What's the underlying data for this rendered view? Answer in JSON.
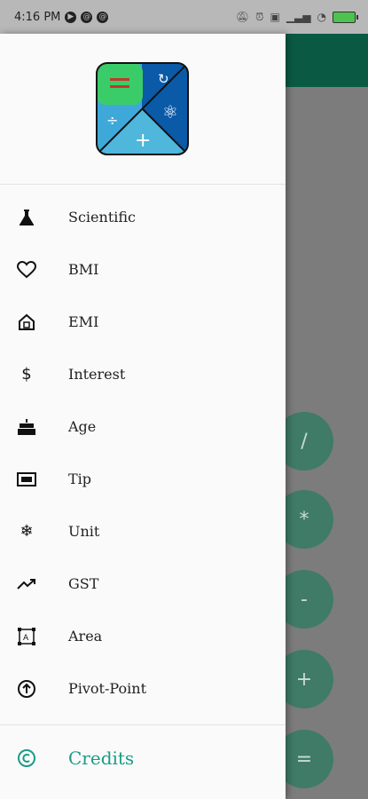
{
  "status_bar": {
    "time": "4:16 PM",
    "notif_icons": [
      "play-icon",
      "sync-icon",
      "sync-icon"
    ],
    "right_icons": [
      "mute-icon",
      "alarm-icon",
      "screen-icon",
      "signal-icon",
      "wifi-icon"
    ],
    "battery_color": "#4ec24e"
  },
  "app": {
    "header_color": "#0a5a43",
    "operator_buttons": [
      "/",
      "*",
      "-",
      "+",
      "="
    ]
  },
  "drawer": {
    "logo_colors": {
      "green": "#3bcc6a",
      "blue": "#0a5aa8",
      "sky": "#3ea9d8",
      "border": "#111111"
    },
    "items": [
      {
        "label": "Scientific",
        "icon": "flask-icon"
      },
      {
        "label": "BMI",
        "icon": "heart-icon"
      },
      {
        "label": "EMI",
        "icon": "home-icon"
      },
      {
        "label": "Interest",
        "icon": "dollar-icon"
      },
      {
        "label": "Age",
        "icon": "cake-icon"
      },
      {
        "label": "Tip",
        "icon": "money-icon"
      },
      {
        "label": "Unit",
        "icon": "snowflake-icon"
      },
      {
        "label": "GST",
        "icon": "trending-up-icon"
      },
      {
        "label": "Area",
        "icon": "area-select-icon"
      },
      {
        "label": "Pivot-Point",
        "icon": "arrow-up-circle-icon"
      }
    ],
    "credits": {
      "label": "Credits",
      "icon": "copyright-icon",
      "color": "#1a9c86"
    }
  }
}
